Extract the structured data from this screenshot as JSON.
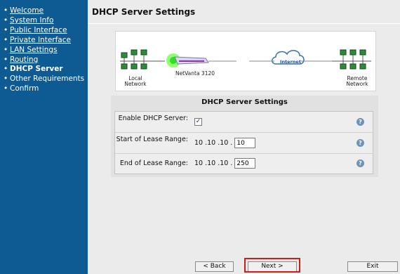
{
  "sidebar": {
    "items": [
      {
        "label": "Welcome"
      },
      {
        "label": "System Info"
      },
      {
        "label": "Public Interface"
      },
      {
        "label": "Private Interface"
      },
      {
        "label": "LAN Settings"
      },
      {
        "label": "Routing"
      },
      {
        "label": "DHCP Server"
      },
      {
        "label": "Other Requirements"
      },
      {
        "label": "Confirm"
      }
    ]
  },
  "header": {
    "title": "DHCP Server Settings"
  },
  "diagram": {
    "local_label": "Local Network",
    "device_label": "NetVanta 3120",
    "internet_label": "Internet",
    "remote_label": "Remote Network"
  },
  "panel": {
    "title": "DHCP Server Settings",
    "enable_label": "Enable DHCP Server:",
    "enable_checked": true,
    "start_label": "Start of Lease Range:",
    "start_prefix": "10 .10 .10 .",
    "start_value": "10",
    "end_label": "End of Lease Range:",
    "end_prefix": "10 .10 .10 .",
    "end_value": "250",
    "help_symbol": "?"
  },
  "buttons": {
    "back": "< Back",
    "next": "Next >",
    "exit": "Exit"
  }
}
